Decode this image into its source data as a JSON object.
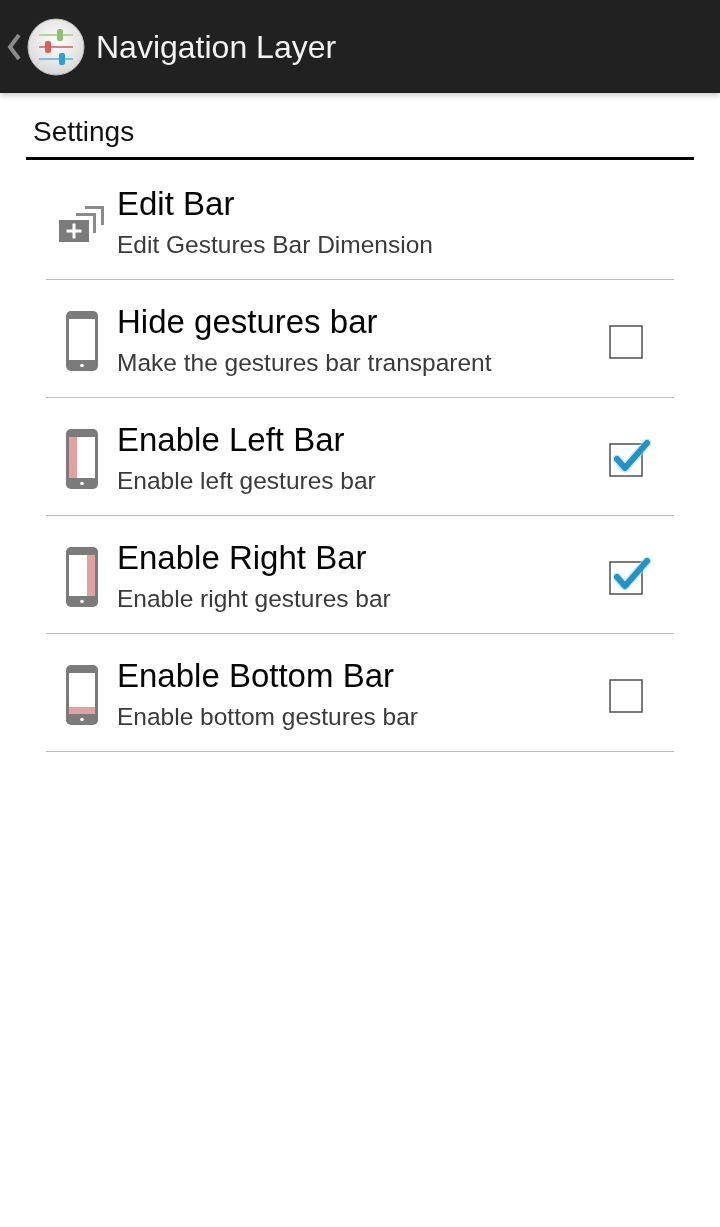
{
  "app_bar": {
    "title": "Navigation Layer"
  },
  "section": {
    "title": "Settings"
  },
  "items": [
    {
      "kind": "action",
      "title": "Edit Bar",
      "summary": "Edit Gestures Bar Dimension"
    },
    {
      "kind": "toggle",
      "title": "Hide gestures bar",
      "summary": "Make the gestures bar transparent",
      "checked": false
    },
    {
      "kind": "toggle",
      "title": "Enable Left Bar",
      "summary": "Enable left gestures bar",
      "checked": true
    },
    {
      "kind": "toggle",
      "title": "Enable Right Bar",
      "summary": "Enable right gestures bar",
      "checked": true
    },
    {
      "kind": "toggle",
      "title": "Enable Bottom Bar",
      "summary": "Enable bottom gestures bar",
      "checked": false
    }
  ]
}
